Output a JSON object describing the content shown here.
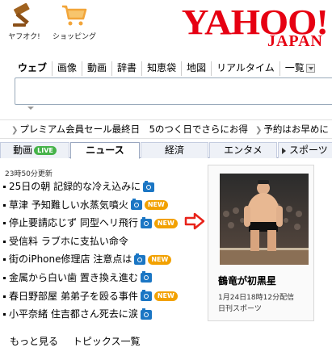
{
  "header": {
    "auction_label": "ヤフオク!",
    "shopping_label": "ショッピング",
    "logo_text": "YAHOO!",
    "logo_sub": "JAPAN"
  },
  "search": {
    "tabs": [
      "ウェブ",
      "画像",
      "動画",
      "辞書",
      "知恵袋",
      "地図",
      "リアルタイム",
      "一覧"
    ]
  },
  "promo": {
    "item1": "プレミアム会員セール最終日　5のつく日でさらにお得",
    "item2": "予約はお早めに"
  },
  "news_tabs": {
    "tab1": "動画",
    "live_badge": "LIVE",
    "tab2": "ニュース",
    "tab3": "経済",
    "tab4": "エンタメ",
    "tab5": "スポーツ"
  },
  "news": {
    "updated": "23時50分更新",
    "items": [
      {
        "title": "25日の朝 記録的な冷え込みに",
        "camera": true,
        "new": false
      },
      {
        "title": "草津 予知難しい水蒸気噴火",
        "camera": true,
        "new": true
      },
      {
        "title": "停止要請応じず 同型ヘリ飛行",
        "camera": true,
        "new": true
      },
      {
        "title": "受信料 ラブホに支払い命令",
        "camera": false,
        "new": false
      },
      {
        "title": "街のiPhone修理店 注意点は",
        "camera": true,
        "new": true
      },
      {
        "title": "金属から白い歯 置き換え進む",
        "camera": true,
        "new": false
      },
      {
        "title": "春日野部屋 弟弟子を殴る事件",
        "camera": true,
        "new": true
      },
      {
        "title": "小平奈緒 住吉都さん死去に涙",
        "camera": true,
        "new": false
      }
    ],
    "new_label": "NEW",
    "more": "もっと見る",
    "topics_list": "トピックス一覧"
  },
  "topic": {
    "caption": "鶴竜が初黒星",
    "date": "1月24日18時12分配信",
    "source": "日刊スポーツ"
  },
  "colors": {
    "logo_red": "#e60012",
    "camera_blue": "#1b76c4",
    "new_orange": "#f2a100",
    "live_green": "#46b34a",
    "arrow_red": "#e8231a",
    "icon_orange": "#f2a53a",
    "gavel_brown": "#a0621f"
  }
}
